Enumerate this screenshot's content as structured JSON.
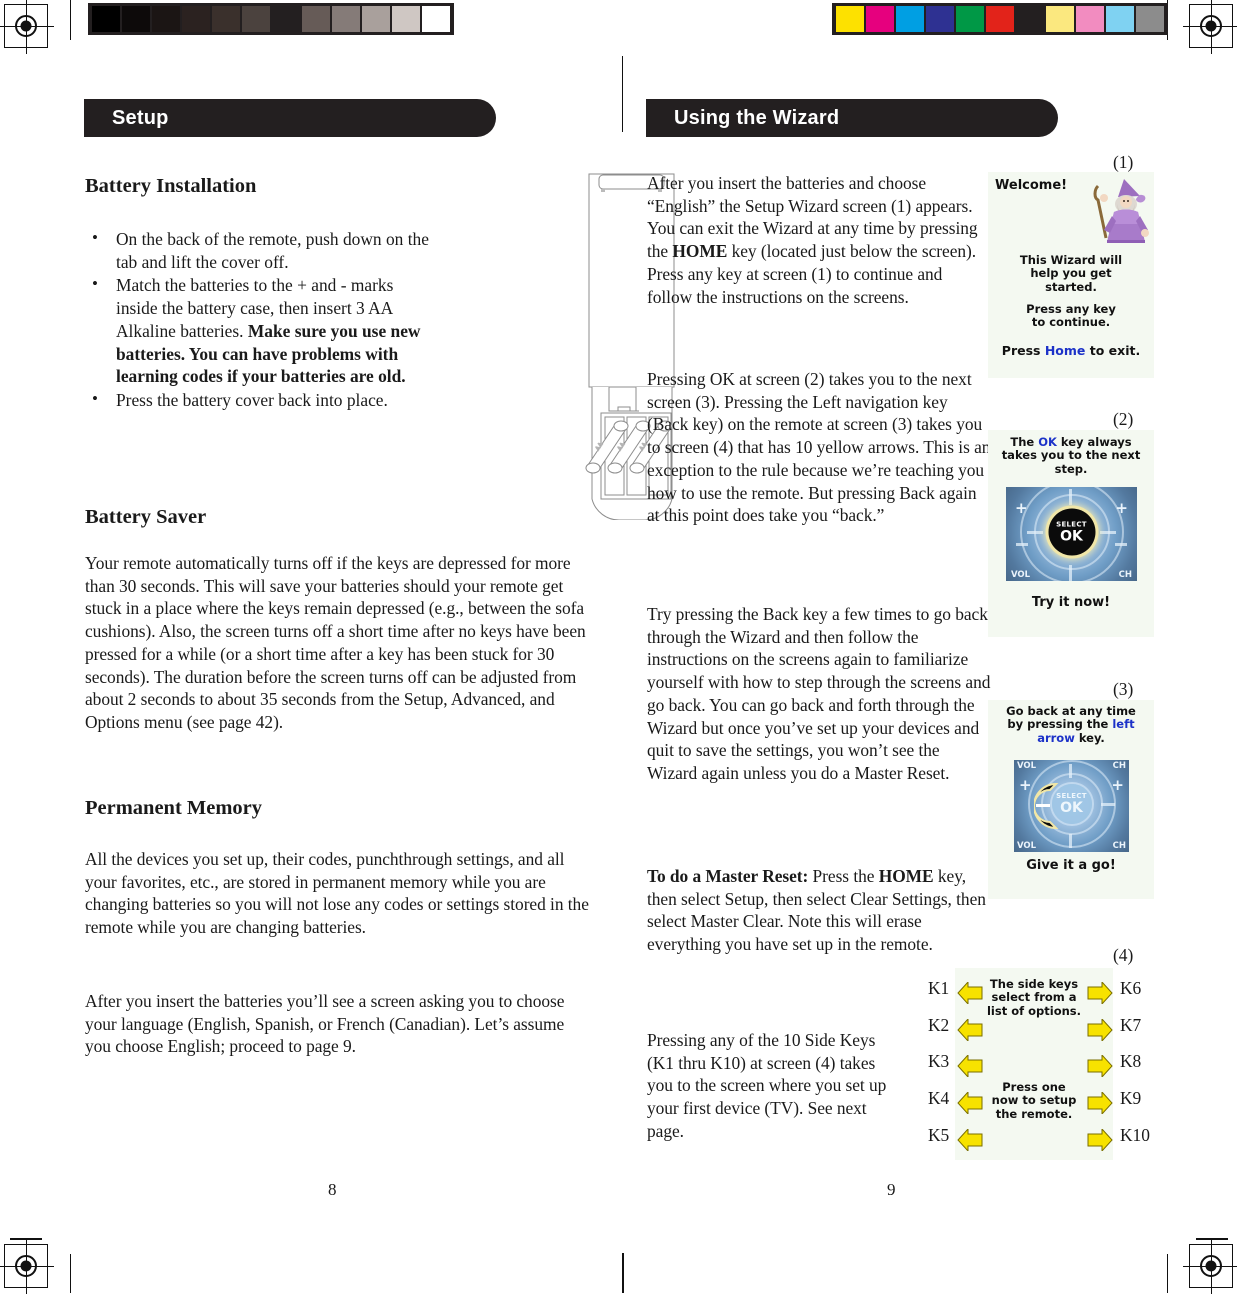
{
  "document": {
    "left_page_number": "8",
    "right_page_number": "9"
  },
  "left_column": {
    "band_title": "Setup",
    "battery_installation": {
      "heading": "Battery Installation",
      "bullets": [
        {
          "text": "On the back of the remote, push down on the tab and lift the cover off.",
          "bold_tail": ""
        },
        {
          "text": "Match the batteries to the + and - marks inside the battery case, then insert 3 AA Alkaline batteries. ",
          "bold_tail": "Make sure you use new batteries. You can have problems with learning codes if your batteries are old."
        },
        {
          "text": "Press the battery cover back into place.",
          "bold_tail": ""
        }
      ]
    },
    "battery_saver": {
      "heading": "Battery Saver",
      "paragraph": "Your remote automatically turns off if the keys are depressed for more than 30 seconds. This will save your batteries should your remote get stuck in a place where the keys remain depressed (e.g., between the sofa cushions). Also, the screen turns off a short time after no keys have been pressed for a while (or a short time after a key has been stuck for 30 seconds). The duration before the screen turns off can be adjusted from about 2 seconds to about 35 seconds from the Setup, Advanced, and Options menu (see page 42)."
    },
    "permanent_memory": {
      "heading": "Permanent Memory",
      "paragraph_1": "All the devices you set up, their codes, punchthrough settings, and all your favorites, etc., are stored in permanent memory while you are changing batteries so you will not lose any codes or settings stored in the remote while you are changing batteries.",
      "paragraph_2": "After you insert the batteries you’ll see a screen asking you to choose your language (English, Spanish, or French (Canadian). Let’s assume you choose English; proceed to page 9."
    },
    "figure": {
      "name": "remote-battery-compartment-diagram",
      "caption": ""
    }
  },
  "right_column": {
    "band_title": "Using the Wizard",
    "paragraphs": [
      {
        "id": "p1_a",
        "text": "After you insert the batteries and choose “English” the Setup Wizard screen (1) appears. You can exit the Wizard at any time by pressing the "
      },
      {
        "id": "p1_bold",
        "text": "HOME"
      },
      {
        "id": "p1_b",
        "text": " key (located just below the screen). Press any key at screen (1) to continue and follow the instructions on the screens."
      },
      {
        "id": "p2",
        "text": "Pressing OK at screen (2) takes you to the next screen (3). Pressing the Left navigation key (Back key) on the remote at screen (3) takes you to screen (4) that has 10 yellow arrows. This is an exception to the rule because we’re teaching you how to use the remote. But pressing Back again at this point does take you “back.”"
      },
      {
        "id": "p3",
        "text": "Try pressing the Back key a few times to go back through the Wizard and then follow the instructions on the screens again to familiarize yourself with how to step through the screens and go back. You can go back and forth through the Wizard but once you’ve set up your devices and quit to save the settings, you won’t see the Wizard again unless you do a Master Reset."
      },
      {
        "id": "p4_bold1",
        "text": "To do a Master Reset:"
      },
      {
        "id": "p4_a",
        "text": " Press the "
      },
      {
        "id": "p4_bold2",
        "text": "HOME"
      },
      {
        "id": "p4_b",
        "text": " key, then select Setup, then select Clear Settings, then select Master Clear. Note this will erase everything you have set up in the remote."
      },
      {
        "id": "p5",
        "text": "Pressing any of the 10 Side Keys (K1 thru K10) at screen (4) takes you to the screen where you set up your first device (TV). See next page."
      }
    ],
    "screens": [
      {
        "label": "(1)",
        "name": "wizard-welcome-screen",
        "lines": [
          "Welcome!",
          "This Wizard will",
          "help you get",
          "started.",
          "Press any key",
          "to continue.",
          "Press Home to exit."
        ],
        "title_text": "Welcome!",
        "body_text_1": "This Wizard will\nhelp you get\nstarted.",
        "body_text_2": "Press any key\nto continue.",
        "footer_pre": "Press ",
        "footer_link": "Home",
        "footer_post": " to exit."
      },
      {
        "label": "(2)",
        "name": "ok-key-screen",
        "caption_pre": "The ",
        "caption_link": "OK",
        "caption_post": " key always\ntakes you to the next\nstep.",
        "pad_ok_label": "OK",
        "pad_select_label": "SELECT",
        "footer": "Try it now!"
      },
      {
        "label": "(3)",
        "name": "left-arrow-back-screen",
        "caption_pre": "Go back at any time\nby pressing the ",
        "caption_link": "left\narrow",
        "caption_post": " key.",
        "pad_ok_label": "OK",
        "pad_select_label": "SELECT",
        "pad_corner_tl": "VOL",
        "pad_corner_tr": "CH",
        "pad_corner_bl": "VOL",
        "pad_corner_br": "CH",
        "footer": "Give it a go!"
      },
      {
        "label": "(4)",
        "name": "side-keys-screen",
        "text_top": "The side keys\nselect from a\nlist of options.",
        "text_bottom": "Press one\nnow to setup\nthe remote.",
        "keys_left": [
          "K1",
          "K2",
          "K3",
          "K4",
          "K5"
        ],
        "keys_right": [
          "K6",
          "K7",
          "K8",
          "K9",
          "K10"
        ]
      }
    ]
  },
  "colors": {
    "band_background": "#231f20",
    "band_text": "#ffffff",
    "lcd_background": "#f4f9f1",
    "lcd_link_text": "#1c32c8",
    "arrow_yellow": "#f7e200",
    "body_text": "#1a1a1a"
  },
  "calibration": {
    "gray_swatches": [
      "#000000",
      "#0d0a0a",
      "#1b1514",
      "#2b2220",
      "#3a302c",
      "#4b423e",
      "#65595500",
      "#665b57",
      "#857b78",
      "#a9a09c",
      "#cfc7c3",
      "#ffffff"
    ],
    "color_swatches": [
      "#fde100",
      "#e6007e",
      "#009fe3",
      "#2e3192",
      "#009846",
      "#e2231a",
      "#231f20",
      "#fbe87f",
      "#f28cc0",
      "#7fd2f2",
      "#8c8c8c"
    ]
  }
}
